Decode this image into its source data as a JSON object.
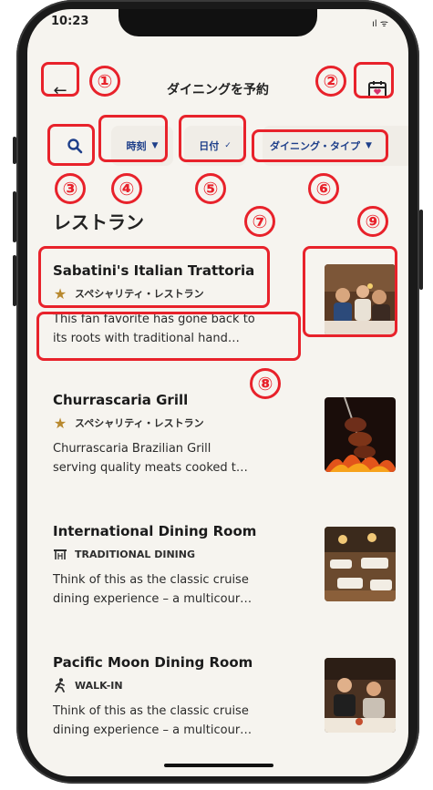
{
  "status_bar": {
    "time": "10:23",
    "icons": "ıl ᯤ"
  },
  "header": {
    "back_icon": "arrow-left-icon",
    "title": "ダイニングを予約",
    "calendar_icon": "calendar-heart-icon"
  },
  "filters": {
    "search_icon": "search-icon",
    "time_label": "時刻",
    "date_label": "日付",
    "dining_type_label": "ダイニング・タイプ"
  },
  "section_heading": "レストラン",
  "restaurants": [
    {
      "name": "Sabatini's Italian Trattoria",
      "category": "スペシャリティ・レストラン",
      "category_icon": "star-icon",
      "desc_line1": "This fan favorite has gone back to",
      "desc_line2": "its roots with traditional hand…"
    },
    {
      "name": "Churrascaria Grill",
      "category": "スペシャリティ・レストラン",
      "category_icon": "star-icon",
      "desc_line1": "Churrascaria Brazilian Grill",
      "desc_line2": "serving quality meats cooked t…"
    },
    {
      "name": "International Dining Room",
      "category": "TRADITIONAL DINING",
      "category_icon": "dining-table-icon",
      "desc_line1": "Think of this as the classic cruise",
      "desc_line2": "dining experience – a multicour…"
    },
    {
      "name": "Pacific Moon Dining Room",
      "category": "WALK-IN",
      "category_icon": "walking-person-icon",
      "desc_line1": "Think of this as the classic cruise",
      "desc_line2": "dining experience – a multicour…"
    }
  ],
  "annotations": [
    "①",
    "②",
    "③",
    "④",
    "⑤",
    "⑥",
    "⑦",
    "⑧",
    "⑨"
  ],
  "colors": {
    "annotation_red": "#e8222b",
    "accent_blue": "#1e3f8a",
    "star_gold": "#b8892f",
    "calendar_pink": "#d6336c"
  }
}
